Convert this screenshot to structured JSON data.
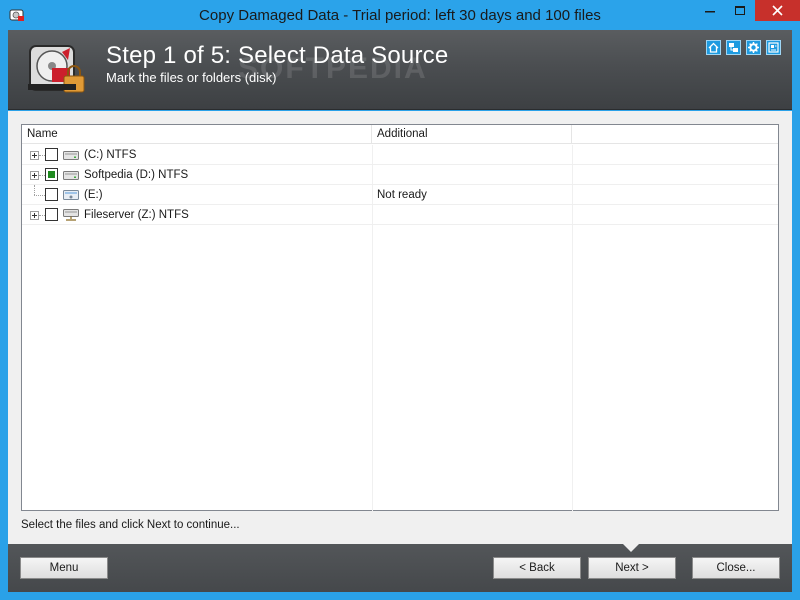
{
  "window": {
    "title": "Copy Damaged Data - Trial period: left 30 days and 100 files",
    "controls": {
      "minimize": "—",
      "maximize": "☐",
      "close": "✕"
    }
  },
  "header": {
    "step_title": "Step 1 of 5: Select Data Source",
    "step_subtitle": "Mark the files or folders (disk)",
    "watermark": "SOFTPEDIA",
    "icons": [
      "home-icon",
      "network-icon",
      "gear-icon",
      "info-icon"
    ]
  },
  "tree": {
    "columns": {
      "name": "Name",
      "additional": "Additional"
    },
    "rows": [
      {
        "name": "(C:) NTFS",
        "additional": "",
        "checked": false,
        "expandable": true,
        "icon": "hard-drive-icon"
      },
      {
        "name": "Softpedia (D:) NTFS",
        "additional": "",
        "checked": true,
        "expandable": true,
        "icon": "hard-drive-icon"
      },
      {
        "name": "(E:)",
        "additional": "Not ready",
        "checked": false,
        "expandable": false,
        "icon": "optical-drive-icon"
      },
      {
        "name": "Fileserver (Z:) NTFS",
        "additional": "",
        "checked": false,
        "expandable": true,
        "icon": "network-drive-icon"
      }
    ]
  },
  "hint": "Select the files and click Next to continue...",
  "buttons": {
    "menu": "Menu",
    "back": "< Back",
    "next": "Next >",
    "close": "Close..."
  },
  "colors": {
    "titlebar": "#2ba3ea",
    "header_bg": "#4b4e51",
    "close_button": "#c7302b",
    "checked": "#1f8a1f"
  }
}
